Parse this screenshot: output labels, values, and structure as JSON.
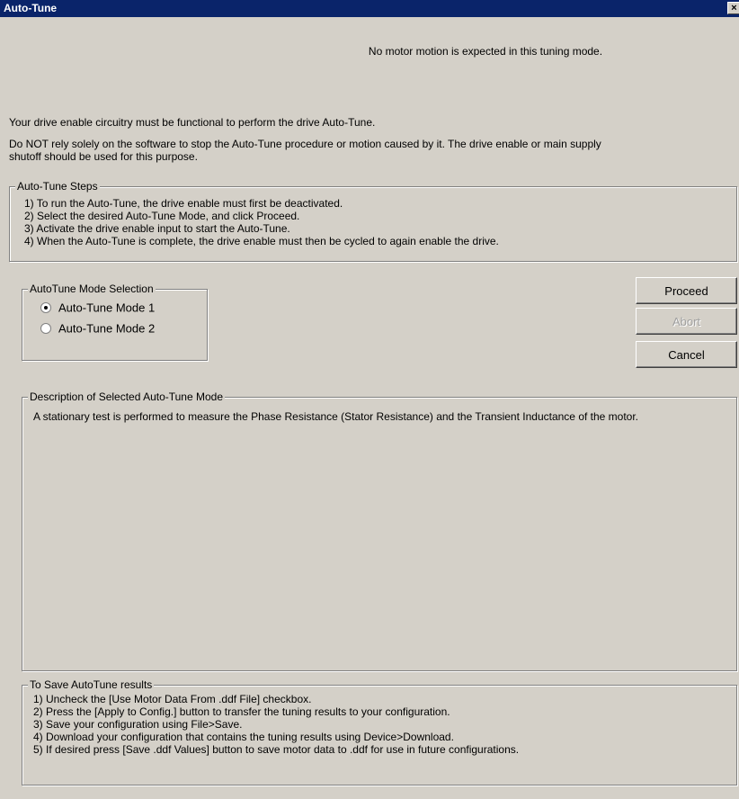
{
  "window": {
    "title": "Auto-Tune",
    "close_glyph": "×"
  },
  "notices": {
    "motion": "No motor motion is expected in this tuning mode.",
    "enable_circuitry": "Your drive enable circuitry must be functional to perform the drive Auto-Tune.",
    "warning_line1": "Do NOT rely solely on the software to stop the Auto-Tune procedure or motion caused by it.  The drive enable or main supply",
    "warning_line2": "shutoff should be used for this purpose."
  },
  "steps": {
    "legend": "Auto-Tune Steps",
    "lines": [
      "1) To run the Auto-Tune, the drive enable must first be deactivated.",
      "2) Select the desired Auto-Tune Mode, and click Proceed.",
      "3) Activate the drive enable input to start the Auto-Tune.",
      "4) When the Auto-Tune is complete, the drive enable must then be cycled to again enable the drive."
    ]
  },
  "mode_selection": {
    "legend": "AutoTune Mode Selection",
    "options": [
      {
        "label": "Auto-Tune Mode 1",
        "selected": true
      },
      {
        "label": "Auto-Tune Mode 2",
        "selected": false
      }
    ]
  },
  "buttons": {
    "proceed": "Proceed",
    "abort": "Abort",
    "cancel": "Cancel"
  },
  "description": {
    "legend": "Description of Selected Auto-Tune Mode",
    "text": "A stationary test is performed to measure the Phase Resistance (Stator Resistance) and the Transient Inductance of the motor."
  },
  "save_results": {
    "legend": "To Save AutoTune results",
    "lines": [
      "1) Uncheck the [Use Motor Data From .ddf File] checkbox.",
      "2) Press the [Apply to Config.] button to transfer the tuning results to your configuration.",
      "3) Save your configuration using File>Save.",
      "4) Download your configuration that contains the tuning results using Device>Download.",
      "5) If desired press [Save .ddf Values] button to save motor data to .ddf for use in future configurations."
    ]
  },
  "colors": {
    "titlebar": "#0a246a",
    "dialog_face": "#d4d0c8",
    "disabled_text": "#a0a0a0"
  }
}
